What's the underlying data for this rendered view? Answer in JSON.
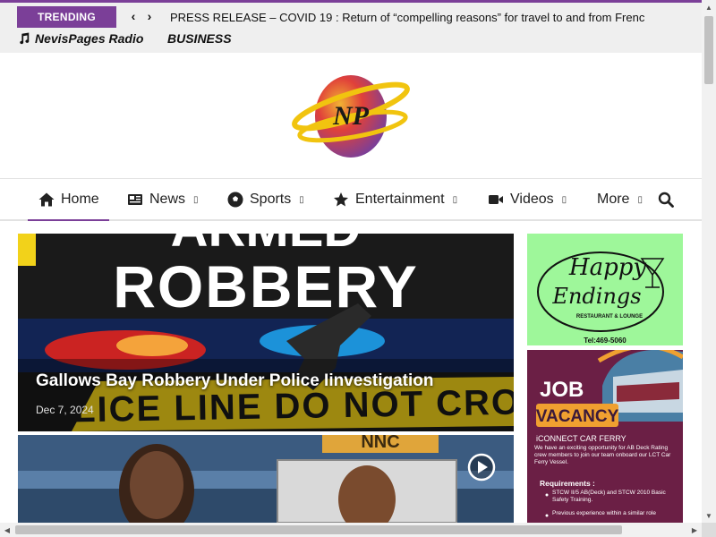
{
  "colors": {
    "accent": "#7b3f98",
    "topbar_bg": "#efefef",
    "ad1_bg": "#9ef79a",
    "ad2_bg": "#6b1f45",
    "ad2_accent": "#f0a030"
  },
  "topbar": {
    "trending_label": "TRENDING",
    "prev_icon": "chevron-left-icon",
    "next_icon": "chevron-right-icon",
    "trending_headline": "PRESS RELEASE – COVID 19 : Return of “compelling reasons” for travel to and from Frenc",
    "radio_label": "NevisPages Radio",
    "radio_icon": "music-note-icon",
    "business_label": "BUSINESS"
  },
  "logo": {
    "monogram": "NP"
  },
  "nav": {
    "items": [
      {
        "label": "Home",
        "icon": "home-icon",
        "active": true,
        "has_dropdown": false
      },
      {
        "label": "News",
        "icon": "newspaper-icon",
        "active": false,
        "has_dropdown": true
      },
      {
        "label": "Sports",
        "icon": "soccer-ball-icon",
        "active": false,
        "has_dropdown": true
      },
      {
        "label": "Entertainment",
        "icon": "star-icon",
        "active": false,
        "has_dropdown": true
      },
      {
        "label": "Videos",
        "icon": "video-camera-icon",
        "active": false,
        "has_dropdown": true
      },
      {
        "label": "More",
        "icon": "",
        "active": false,
        "has_dropdown": true
      }
    ],
    "dropdown_glyph": "▯",
    "search_icon": "search-icon"
  },
  "articles": [
    {
      "title": "Gallows Bay Robbery Under Police Iinvestigation",
      "date": "Dec 7, 2024",
      "image_text": {
        "line1": "ARMED",
        "line2": "ROBBERY",
        "tape": "POLICE LINE DO NOT CROSS"
      }
    },
    {
      "image_text": {
        "banner": "NNC"
      },
      "play_icon": "play-circle-icon"
    }
  ],
  "ads": [
    {
      "text": {
        "line1": "Happy",
        "line2": "Endings",
        "sub": "RESTAURANT & LOUNGE",
        "tel": "Tel:469-5060"
      }
    },
    {
      "text": {
        "title1": "JOB",
        "title2": "VACANCY",
        "company": "iCONNECT CAR FERRY",
        "body": "We have an exciting opportunity for AB Deck Rating crew members to join our team onboard our LCT Car Ferry Vessel.",
        "req_title": "Requirements :",
        "req1": "STCW II/5 AB(Deck) and STCW 2010 Basic Safety Training.",
        "req2": "Previous experience within a similar role"
      }
    }
  ],
  "scrollbars": {
    "up": "▲",
    "down": "▼",
    "left": "◀",
    "right": "▶"
  }
}
